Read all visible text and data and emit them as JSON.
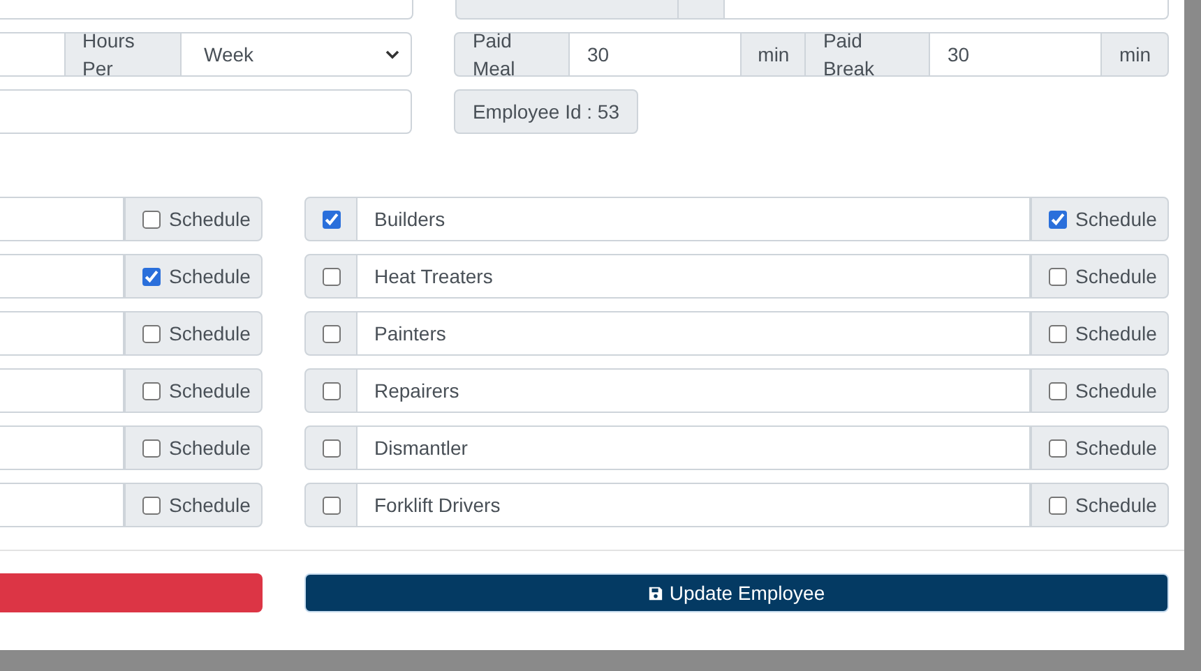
{
  "form": {
    "hours_per": {
      "label": "Hours Per",
      "value": "Week"
    },
    "paid_meal": {
      "label": "Paid Meal",
      "value": "30",
      "unit": "min"
    },
    "paid_break": {
      "label": "Paid Break",
      "value": "30",
      "unit": "min"
    },
    "employee_id": "Employee Id : 53"
  },
  "left_positions": [
    {
      "schedule_label": "Schedule",
      "schedule_checked": false
    },
    {
      "schedule_label": "Schedule",
      "schedule_checked": true
    },
    {
      "schedule_label": "Schedule",
      "schedule_checked": false
    },
    {
      "schedule_label": "Schedule",
      "schedule_checked": false
    },
    {
      "schedule_label": "Schedule",
      "schedule_checked": false
    },
    {
      "schedule_label": "Schedule",
      "schedule_checked": false
    }
  ],
  "right_positions": [
    {
      "name": "Builders",
      "checked": true,
      "schedule_label": "Schedule",
      "schedule_checked": true
    },
    {
      "name": "Heat Treaters",
      "checked": false,
      "schedule_label": "Schedule",
      "schedule_checked": false
    },
    {
      "name": "Painters",
      "checked": false,
      "schedule_label": "Schedule",
      "schedule_checked": false
    },
    {
      "name": "Repairers",
      "checked": false,
      "schedule_label": "Schedule",
      "schedule_checked": false
    },
    {
      "name": "Dismantler",
      "checked": false,
      "schedule_label": "Schedule",
      "schedule_checked": false
    },
    {
      "name": "Forklift Drivers",
      "checked": false,
      "schedule_label": "Schedule",
      "schedule_checked": false
    }
  ],
  "update_button": "Update Employee"
}
